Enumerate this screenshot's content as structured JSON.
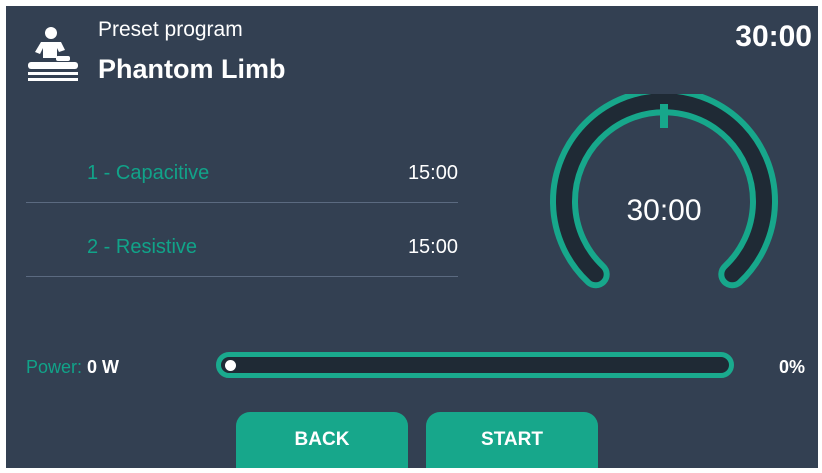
{
  "header": {
    "icon": "massage-therapy-icon",
    "subtitle": "Preset program",
    "title": "Phantom Limb",
    "timer": "30:00"
  },
  "phases": [
    {
      "name": "1 - Capacitive",
      "duration": "15:00"
    },
    {
      "name": "2 - Resistive",
      "duration": "15:00"
    }
  ],
  "gauge": {
    "value": "30:00",
    "fill_fraction": 0
  },
  "power": {
    "label": "Power:",
    "value": "0 W",
    "percent_label": "0%",
    "percent": 0
  },
  "buttons": {
    "back": "BACK",
    "start": "START"
  },
  "colors": {
    "background": "#334052",
    "accent": "#17a78b",
    "track": "#1f2a35"
  }
}
